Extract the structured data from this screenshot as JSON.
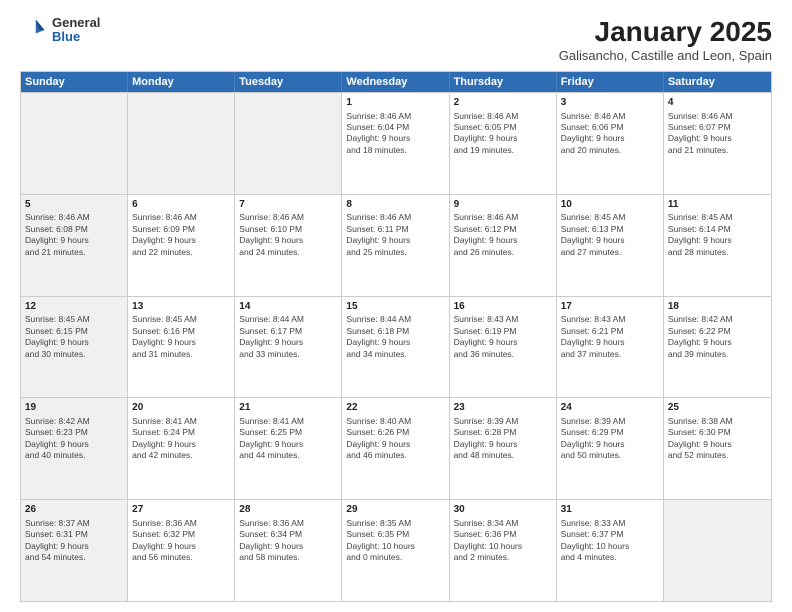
{
  "header": {
    "logo": {
      "general": "General",
      "blue": "Blue"
    },
    "title": "January 2025",
    "subtitle": "Galisancho, Castille and Leon, Spain"
  },
  "calendar": {
    "weekdays": [
      "Sunday",
      "Monday",
      "Tuesday",
      "Wednesday",
      "Thursday",
      "Friday",
      "Saturday"
    ],
    "rows": [
      [
        {
          "day": "",
          "info": "",
          "shaded": true
        },
        {
          "day": "",
          "info": "",
          "shaded": true
        },
        {
          "day": "",
          "info": "",
          "shaded": true
        },
        {
          "day": "1",
          "info": "Sunrise: 8:46 AM\nSunset: 6:04 PM\nDaylight: 9 hours\nand 18 minutes."
        },
        {
          "day": "2",
          "info": "Sunrise: 8:46 AM\nSunset: 6:05 PM\nDaylight: 9 hours\nand 19 minutes."
        },
        {
          "day": "3",
          "info": "Sunrise: 8:46 AM\nSunset: 6:06 PM\nDaylight: 9 hours\nand 20 minutes."
        },
        {
          "day": "4",
          "info": "Sunrise: 8:46 AM\nSunset: 6:07 PM\nDaylight: 9 hours\nand 21 minutes."
        }
      ],
      [
        {
          "day": "5",
          "info": "Sunrise: 8:46 AM\nSunset: 6:08 PM\nDaylight: 9 hours\nand 21 minutes.",
          "shaded": true
        },
        {
          "day": "6",
          "info": "Sunrise: 8:46 AM\nSunset: 6:09 PM\nDaylight: 9 hours\nand 22 minutes."
        },
        {
          "day": "7",
          "info": "Sunrise: 8:46 AM\nSunset: 6:10 PM\nDaylight: 9 hours\nand 24 minutes."
        },
        {
          "day": "8",
          "info": "Sunrise: 8:46 AM\nSunset: 6:11 PM\nDaylight: 9 hours\nand 25 minutes."
        },
        {
          "day": "9",
          "info": "Sunrise: 8:46 AM\nSunset: 6:12 PM\nDaylight: 9 hours\nand 26 minutes."
        },
        {
          "day": "10",
          "info": "Sunrise: 8:45 AM\nSunset: 6:13 PM\nDaylight: 9 hours\nand 27 minutes."
        },
        {
          "day": "11",
          "info": "Sunrise: 8:45 AM\nSunset: 6:14 PM\nDaylight: 9 hours\nand 28 minutes."
        }
      ],
      [
        {
          "day": "12",
          "info": "Sunrise: 8:45 AM\nSunset: 6:15 PM\nDaylight: 9 hours\nand 30 minutes.",
          "shaded": true
        },
        {
          "day": "13",
          "info": "Sunrise: 8:45 AM\nSunset: 6:16 PM\nDaylight: 9 hours\nand 31 minutes."
        },
        {
          "day": "14",
          "info": "Sunrise: 8:44 AM\nSunset: 6:17 PM\nDaylight: 9 hours\nand 33 minutes."
        },
        {
          "day": "15",
          "info": "Sunrise: 8:44 AM\nSunset: 6:18 PM\nDaylight: 9 hours\nand 34 minutes."
        },
        {
          "day": "16",
          "info": "Sunrise: 8:43 AM\nSunset: 6:19 PM\nDaylight: 9 hours\nand 36 minutes."
        },
        {
          "day": "17",
          "info": "Sunrise: 8:43 AM\nSunset: 6:21 PM\nDaylight: 9 hours\nand 37 minutes."
        },
        {
          "day": "18",
          "info": "Sunrise: 8:42 AM\nSunset: 6:22 PM\nDaylight: 9 hours\nand 39 minutes."
        }
      ],
      [
        {
          "day": "19",
          "info": "Sunrise: 8:42 AM\nSunset: 6:23 PM\nDaylight: 9 hours\nand 40 minutes.",
          "shaded": true
        },
        {
          "day": "20",
          "info": "Sunrise: 8:41 AM\nSunset: 6:24 PM\nDaylight: 9 hours\nand 42 minutes."
        },
        {
          "day": "21",
          "info": "Sunrise: 8:41 AM\nSunset: 6:25 PM\nDaylight: 9 hours\nand 44 minutes."
        },
        {
          "day": "22",
          "info": "Sunrise: 8:40 AM\nSunset: 6:26 PM\nDaylight: 9 hours\nand 46 minutes."
        },
        {
          "day": "23",
          "info": "Sunrise: 8:39 AM\nSunset: 6:28 PM\nDaylight: 9 hours\nand 48 minutes."
        },
        {
          "day": "24",
          "info": "Sunrise: 8:39 AM\nSunset: 6:29 PM\nDaylight: 9 hours\nand 50 minutes."
        },
        {
          "day": "25",
          "info": "Sunrise: 8:38 AM\nSunset: 6:30 PM\nDaylight: 9 hours\nand 52 minutes."
        }
      ],
      [
        {
          "day": "26",
          "info": "Sunrise: 8:37 AM\nSunset: 6:31 PM\nDaylight: 9 hours\nand 54 minutes.",
          "shaded": true
        },
        {
          "day": "27",
          "info": "Sunrise: 8:36 AM\nSunset: 6:32 PM\nDaylight: 9 hours\nand 56 minutes."
        },
        {
          "day": "28",
          "info": "Sunrise: 8:36 AM\nSunset: 6:34 PM\nDaylight: 9 hours\nand 58 minutes."
        },
        {
          "day": "29",
          "info": "Sunrise: 8:35 AM\nSunset: 6:35 PM\nDaylight: 10 hours\nand 0 minutes."
        },
        {
          "day": "30",
          "info": "Sunrise: 8:34 AM\nSunset: 6:36 PM\nDaylight: 10 hours\nand 2 minutes."
        },
        {
          "day": "31",
          "info": "Sunrise: 8:33 AM\nSunset: 6:37 PM\nDaylight: 10 hours\nand 4 minutes."
        },
        {
          "day": "",
          "info": "",
          "shaded": true
        }
      ]
    ]
  }
}
